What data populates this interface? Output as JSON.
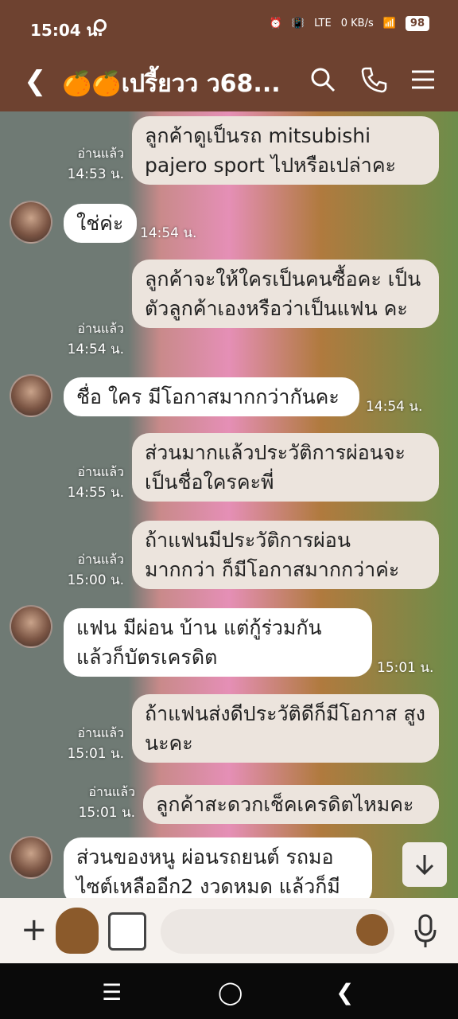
{
  "status": {
    "time": "15:04 น.",
    "battery": "98",
    "data_rate": "0 KB/s",
    "network": "LTE"
  },
  "header": {
    "title": "🍊🍊เปรี้ยวว ว68..."
  },
  "messages": [
    {
      "side": "mine",
      "text": "ลูกค้าดูเป็นรถ mitsubishi pajero sport ไปหรือเปล่าคะ",
      "read": "อ่านแล้ว",
      "time": "14:53 น."
    },
    {
      "side": "theirs",
      "text": "ใช่ค่ะ",
      "time": "14:54 น."
    },
    {
      "side": "mine",
      "text": "ลูกค้าจะให้ใครเป็นคนซื้อคะ เป็นตัวลูกค้าเองหรือว่าเป็นแฟน คะ",
      "read": "อ่านแล้ว",
      "time": "14:54 น."
    },
    {
      "side": "theirs",
      "text": "ชื่อ ใคร มีโอกาสมากกว่ากันคะ",
      "time": "14:54 น."
    },
    {
      "side": "mine",
      "text": "ส่วนมากแล้วประวัติการผ่อนจะ เป็นชื่อใครคะพี่",
      "read": "อ่านแล้ว",
      "time": "14:55 น."
    },
    {
      "side": "mine",
      "text": "ถ้าแฟนมีประวัติการผ่อน มากกว่า ก็มีโอกาสมากกว่าค่ะ",
      "read": "อ่านแล้ว",
      "time": "15:00 น."
    },
    {
      "side": "theirs",
      "text": "แฟน มีผ่อน บ้าน แต่กู้ร่วมกัน แล้วก็บัตรเครดิต",
      "time": "15:01 น."
    },
    {
      "side": "mine",
      "text": "ถ้าแฟนส่งดีประวัติดีก็มีโอกาส สูงนะคะ",
      "read": "อ่านแล้ว",
      "time": "15:01 น."
    },
    {
      "side": "mine",
      "text": "ลูกค้าสะดวกเช็คเครดิตไหมคะ",
      "read": "อ่านแล้ว",
      "time": "15:01 น."
    },
    {
      "side": "theirs",
      "text": "ส่วนของหนู ผ่อนรถยนต์ รถมอ ไซต์เหลืออีก2 งวดหมด แล้วก็มี",
      "time": ""
    }
  ],
  "icons": {
    "back": "chevron-left-icon",
    "search": "search-icon",
    "call": "phone-icon",
    "menu": "menu-icon",
    "scroll": "arrow-down-icon",
    "plus": "plus-icon",
    "mic": "microphone-icon"
  }
}
